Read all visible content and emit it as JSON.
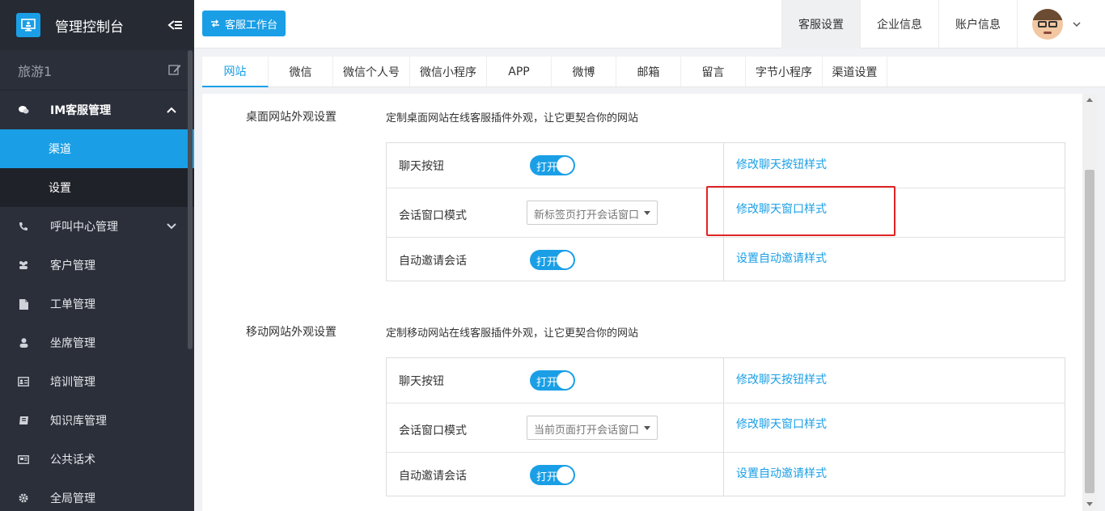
{
  "app": {
    "title": "管理控制台"
  },
  "sidebar": {
    "project": "旅游1",
    "group_open": "IM客服管理",
    "sub_items": [
      "渠道",
      "设置"
    ],
    "items": [
      "呼叫中心管理",
      "客户管理",
      "工单管理",
      "坐席管理",
      "培训管理",
      "知识库管理",
      "公共话术",
      "全局管理"
    ]
  },
  "topbar": {
    "work_button": "客服工作台",
    "nav": [
      "客服设置",
      "企业信息",
      "账户信息"
    ]
  },
  "tabs": [
    "网站",
    "微信",
    "微信个人号",
    "微信小程序",
    "APP",
    "微博",
    "邮箱",
    "留言",
    "字节小程序",
    "渠道设置"
  ],
  "desktop": {
    "title": "桌面网站外观设置",
    "desc": "定制桌面网站在线客服插件外观，让它更契合你的网站",
    "rows": [
      {
        "label": "聊天按钮",
        "toggle": "打开",
        "link": "修改聊天按钮样式"
      },
      {
        "label": "会话窗口模式",
        "select": "新标签页打开会话窗口",
        "link": "修改聊天窗口样式"
      },
      {
        "label": "自动邀请会话",
        "toggle": "打开",
        "link": "设置自动邀请样式"
      }
    ]
  },
  "mobile": {
    "title": "移动网站外观设置",
    "desc": "定制移动网站在线客服插件外观，让它更契合你的网站",
    "rows": [
      {
        "label": "聊天按钮",
        "toggle": "打开",
        "link": "修改聊天按钮样式"
      },
      {
        "label": "会话窗口模式",
        "select": "当前页面打开会话窗口",
        "link": "修改聊天窗口样式"
      },
      {
        "label": "自动邀请会话",
        "toggle": "打开",
        "link": "设置自动邀请样式"
      }
    ]
  },
  "colors": {
    "accent": "#1a9fe6",
    "sidebar_bg": "#2b2f3a",
    "highlight": "#e02424"
  }
}
